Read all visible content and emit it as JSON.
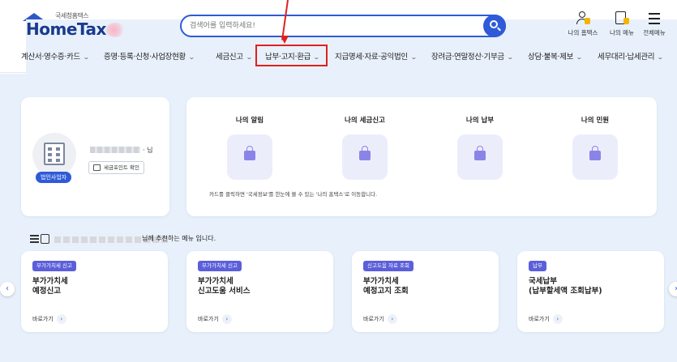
{
  "header": {
    "logo_sub": "국세청홈택스",
    "logo_main": "HomeTax",
    "search_placeholder": "검색어를 입력하세요!",
    "util": [
      {
        "label": "나의 홈택스",
        "icon": "user-icon"
      },
      {
        "label": "나의 메뉴",
        "icon": "my-menu-icon"
      },
      {
        "label": "전체메뉴",
        "icon": "hamburger-menu-icon"
      }
    ]
  },
  "nav": {
    "items": [
      {
        "label": "계산서·영수증·카드"
      },
      {
        "label": "증명·등록·신청·사업장현황"
      },
      {
        "label": "세금신고"
      },
      {
        "label": "납부·고지·환급"
      },
      {
        "label": "지급명세·자료·공익법인"
      },
      {
        "label": "장려금·연말정산·기부금"
      },
      {
        "label": "상담·불복·제보"
      },
      {
        "label": "세무대리·납세관리"
      }
    ],
    "highlight_color": "#e02020"
  },
  "profile": {
    "badge": "법인사업자",
    "name_suffix": "님",
    "point_button": "세금포인트 확인"
  },
  "my_tiles": {
    "items": [
      {
        "label": "나의 알림"
      },
      {
        "label": "나의 세금신고"
      },
      {
        "label": "나의 납부"
      },
      {
        "label": "나의 민원"
      }
    ],
    "note": "카드를 클릭하면 '국세정보'를 한눈에 볼 수 있는 '나의 홈택스'로 이동합니다."
  },
  "recommend": {
    "title_suffix": "님께 추천하는 메뉴 입니다.",
    "cards": [
      {
        "tag": "부가가치세 신고",
        "tag_color": "#5b5fd9",
        "title": "부가가치세\n예정신고",
        "link": "바로가기"
      },
      {
        "tag": "부가가치세 신고",
        "tag_color": "#5b5fd9",
        "title": "부가가치세\n신고도움 서비스",
        "link": "바로가기"
      },
      {
        "tag": "신고도움 자료 조회",
        "tag_color": "#5b5fd9",
        "title": "부가가치세\n예정고지 조회",
        "link": "바로가기"
      },
      {
        "tag": "납부",
        "tag_color": "#5b5fd9",
        "title": "국세납부\n(납부할세액 조회납부)",
        "link": "바로가기"
      }
    ]
  },
  "colors": {
    "brand": "#2f5bd8",
    "background": "#e8f1fb"
  }
}
